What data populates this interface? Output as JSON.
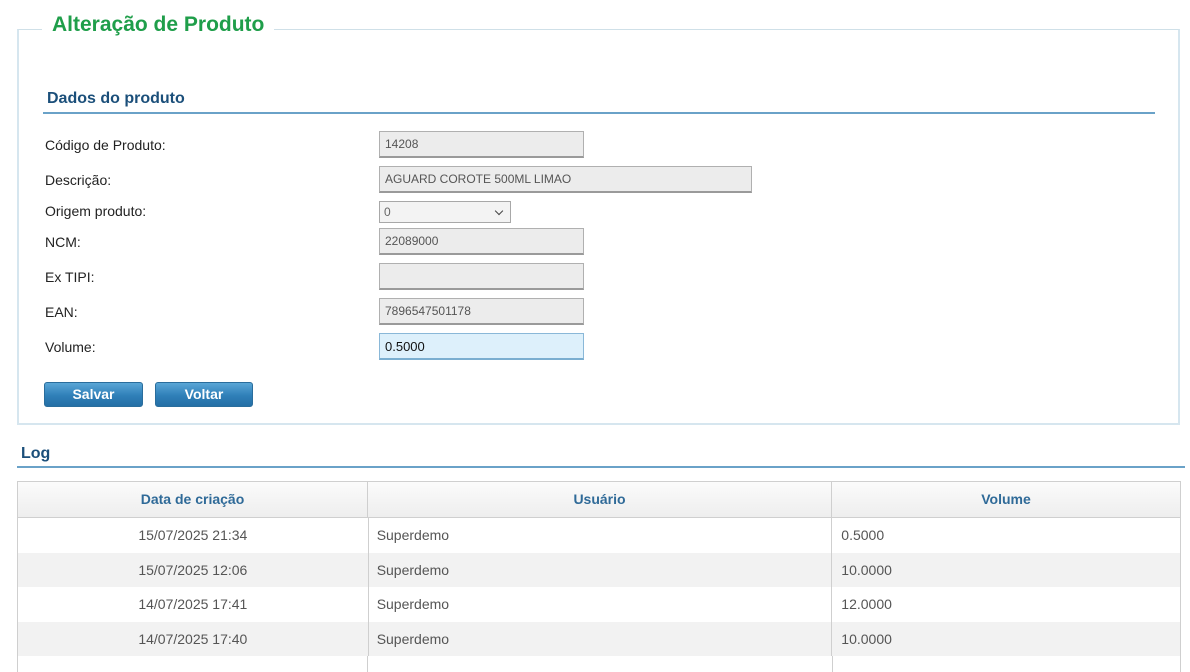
{
  "page": {
    "title": "Alteração de Produto",
    "section_title": "Dados do produto"
  },
  "form": {
    "codigo": {
      "label": "Código de Produto:",
      "value": "14208"
    },
    "descricao": {
      "label": "Descrição:",
      "value": "AGUARD COROTE 500ML LIMAO"
    },
    "origem": {
      "label": "Origem produto:",
      "value": "0"
    },
    "ncm": {
      "label": "NCM:",
      "value": "22089000"
    },
    "ex_tipi": {
      "label": "Ex TIPI:",
      "value": ""
    },
    "ean": {
      "label": "EAN:",
      "value": "7896547501178"
    },
    "volume": {
      "label": "Volume:",
      "value": "0.5000"
    }
  },
  "buttons": {
    "save": "Salvar",
    "back": "Voltar"
  },
  "log": {
    "title": "Log",
    "columns": [
      "Data de criação",
      "Usuário",
      "Volume"
    ],
    "rows": [
      [
        "15/07/2025 21:34",
        "Superdemo",
        "0.5000"
      ],
      [
        "15/07/2025 12:06",
        "Superdemo",
        "10.0000"
      ],
      [
        "14/07/2025 17:41",
        "Superdemo",
        "12.0000"
      ],
      [
        "14/07/2025 17:40",
        "Superdemo",
        "10.0000"
      ]
    ]
  }
}
